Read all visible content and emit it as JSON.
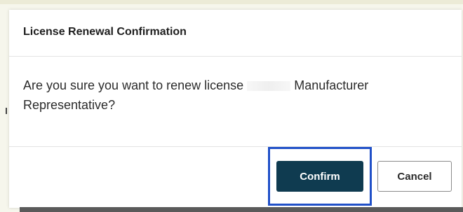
{
  "dialog": {
    "title": "License Renewal Confirmation",
    "message_before": "Are you sure you want to renew license",
    "message_after": "Manufacturer Representative?",
    "confirm_label": "Confirm",
    "cancel_label": "Cancel"
  },
  "colors": {
    "confirm_button": "#0f3b50",
    "focus_ring": "#2050c8"
  }
}
